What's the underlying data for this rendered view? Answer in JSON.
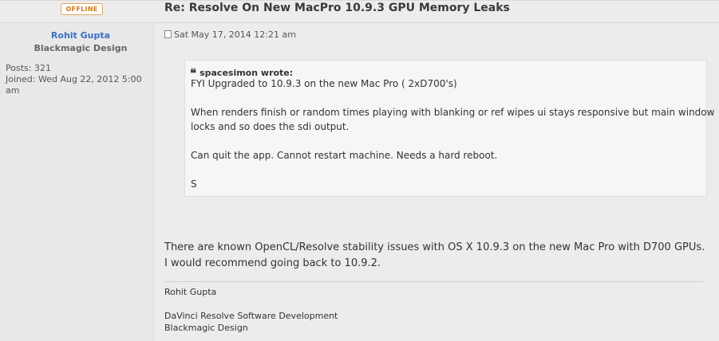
{
  "status_badge": "OFFLINE",
  "post": {
    "title": "Re: Resolve On New MacPro 10.9.3 GPU Memory Leaks",
    "timestamp": "Sat May 17, 2014 12:21 am",
    "body": "There are known OpenCL/Resolve stability issues with OS X 10.9.3 on the new Mac Pro with D700 GPUs. I would recommend going back to 10.9.2."
  },
  "author": {
    "name": "Rohit Gupta",
    "rank": "Blackmagic Design",
    "posts_label": "Posts:",
    "posts_value": "321",
    "joined_label": "Joined:",
    "joined_value": "Wed Aug 22, 2012 5:00 am"
  },
  "quote": {
    "icon": "quote-icon",
    "author_text": "spacesimon wrote:",
    "lines": [
      "FYI Upgraded to 10.9.3 on the new Mac Pro ( 2xD700's)",
      "When renders finish or random times playing with blanking or ref wipes ui stays responsive but main window",
      "locks and so does the sdi output.",
      "Can quit the app. Cannot restart machine. Needs a hard reboot.",
      "S"
    ]
  },
  "signature": {
    "line1": "Rohit Gupta",
    "line2": "DaVinci Resolve Software Development",
    "line3": "Blackmagic Design"
  },
  "colors": {
    "author_link": "#3b6fc4",
    "offline_badge": "#d07a17",
    "background": "#ececec"
  }
}
